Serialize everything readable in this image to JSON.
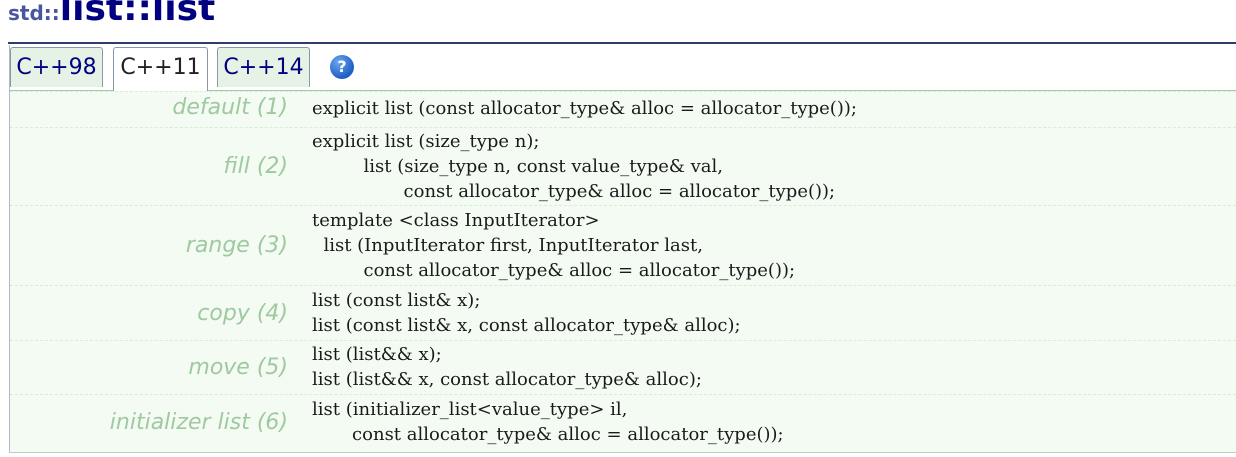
{
  "title": {
    "namespace": "std::",
    "name": "list::list"
  },
  "tabs": [
    {
      "label": "C++98",
      "active": false
    },
    {
      "label": "C++11",
      "active": true
    },
    {
      "label": "C++14",
      "active": false
    }
  ],
  "help_icon": "question-icon",
  "constructors": [
    {
      "label": "default (1)",
      "code": "explicit list (const allocator_type& alloc = allocator_type());"
    },
    {
      "label": "fill (2)",
      "code": "explicit list (size_type n);\n         list (size_type n, const value_type& val,\n                const allocator_type& alloc = allocator_type());"
    },
    {
      "label": "range (3)",
      "code": "template <class InputIterator>\n  list (InputIterator first, InputIterator last,\n         const allocator_type& alloc = allocator_type());"
    },
    {
      "label": "copy (4)",
      "code": "list (const list& x);\nlist (const list& x, const allocator_type& alloc);"
    },
    {
      "label": "move (5)",
      "code": "list (list&& x);\nlist (list&& x, const allocator_type& alloc);"
    },
    {
      "label": "initializer list (6)",
      "code": "list (initializer_list<value_type> il,\n       const allocator_type& alloc = allocator_type());"
    }
  ],
  "colors": {
    "title": "#000080",
    "label": "#9fc99f",
    "panel_bg": "#f3fbf3",
    "rule": "#2e3d6b"
  }
}
